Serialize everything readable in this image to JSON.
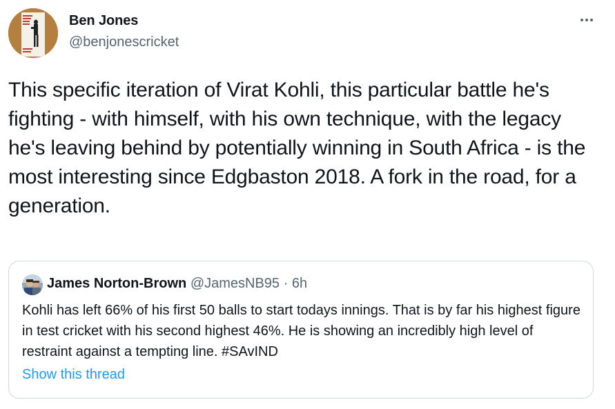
{
  "tweet": {
    "author_name": "Ben Jones",
    "author_handle": "@benjonescricket",
    "text": "This specific iteration of Virat Kohli, this particular battle he's fighting - with himself, with his own technique, with the legacy he's leaving behind by potentially winning in South Africa - is the most interesting since Edgbaston 2018. A fork in the road, for a generation.",
    "avatar_icon": "book-cover-avatar",
    "more_icon": "more-options-icon"
  },
  "quote": {
    "author_name": "James Norton-Brown",
    "author_handle": "@JamesNB95",
    "separator": "·",
    "time": "6h",
    "text": "Kohli has left 66% of his first 50 balls to start todays innings. That is by far his highest figure in test cricket with his second highest 46%. He is showing an incredibly high level of restraint against a tempting line. #SAvIND",
    "show_thread": "Show this thread"
  },
  "colors": {
    "text": "#0f1419",
    "secondary": "#536471",
    "link": "#1d9bf0",
    "border": "#cfd9de"
  }
}
